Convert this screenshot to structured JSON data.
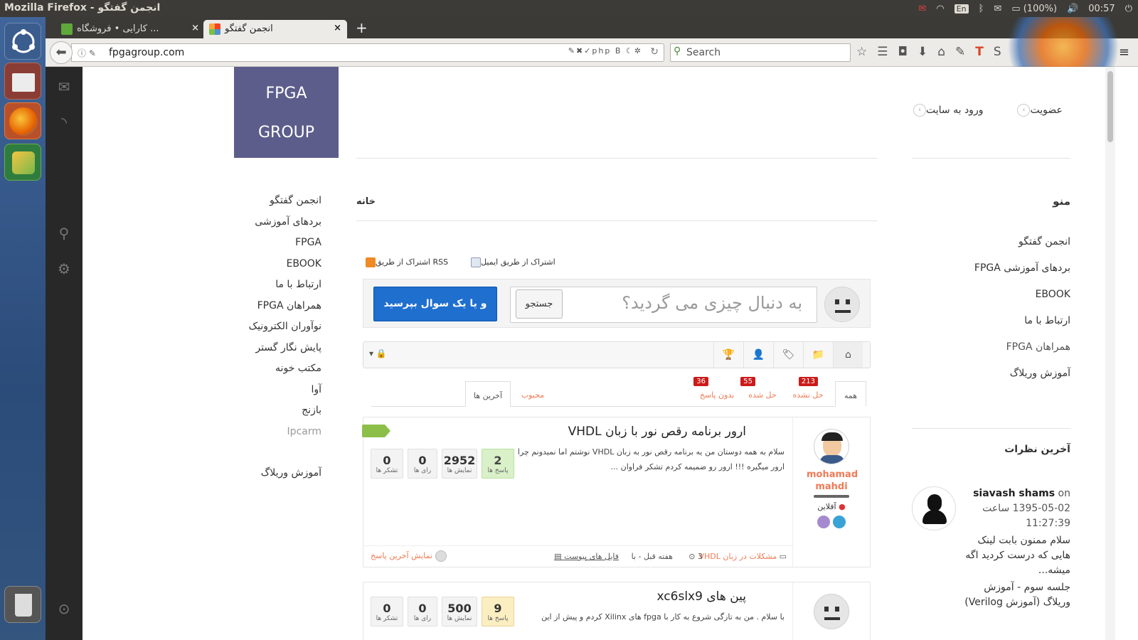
{
  "os": {
    "window_title": "Mozilla Firefox - انجمن گفتگو",
    "tray": {
      "lang": "En",
      "battery": "(100%)",
      "clock": "00:57"
    }
  },
  "browser": {
    "tabs": [
      {
        "label": "کارایی • فروشگاه ...",
        "active": false
      },
      {
        "label": "انجمن گفتگو",
        "active": true
      }
    ],
    "new_tab": "+",
    "url": "fpgagroup.com",
    "search_placeholder": "Search"
  },
  "site": {
    "logo_line1": "FPGA",
    "logo_line2": "GROUP",
    "auth": {
      "register": "عضویت",
      "login": "ورود به سایت"
    },
    "breadcrumb": "خانه",
    "left_menu": [
      "انجمن گفتگو",
      "بردهای آموزشی",
      "FPGA",
      "EBOOK",
      "ارتباط با ما",
      "همراهان FPGA",
      "نوآوران الکترونیک",
      "پایش نگار گستر",
      "مکتب خونه",
      "آوا",
      "بازنج",
      "Ipcarm",
      "آموزش وریلاگ"
    ],
    "right_menu": {
      "heading": "منو",
      "items": [
        "انجمن گفتگو",
        "بردهای آموزشی FPGA",
        "EBOOK",
        "ارتباط با ما",
        "همراهان FPGA",
        "آموزش وریلاگ"
      ]
    },
    "share": {
      "email": "اشتراک از طریق ایمیل",
      "rss": "اشتراک از طریق RSS"
    },
    "ask": {
      "button": "و یا یک سوال بپرسید",
      "search_placeholder": "به دنبال چیزی می گردید؟",
      "search_button": "جستجو"
    },
    "filters": {
      "all": "همه",
      "unsolved": "حل نشده",
      "unsolved_count": "213",
      "solved": "حل شده",
      "solved_count": "55",
      "unanswered": "بدون پاسخ",
      "unanswered_count": "36",
      "latest": "آخرین ها",
      "popular": "محبوب"
    },
    "questions": [
      {
        "author": "mohamad mahdi",
        "status": "آفلاین",
        "title": "ارور برنامه رقص نور با زبان VHDL",
        "excerpt": "سلام به همه دوستان من یه برنامه رقص نور به زبان VHDL نوشتم اما نمیدونم چرا ارور میگیره !!! ارور رو ضمیمه کردم تشکر فراوان ...",
        "stats": {
          "answers": "2",
          "answers_label": "پاسخ ها",
          "views": "2952",
          "views_label": "نمایش ها",
          "votes": "0",
          "votes_label": "رای ها",
          "thanks": "0",
          "thanks_label": "تشکر ها"
        },
        "foot_category": "مشکلات در زبان VHDL",
        "foot_count": "3",
        "foot_time": "هفته قبل - با",
        "foot_attach": "فایل های پیوست",
        "foot_last": "نمایش آخرین پاسخ"
      },
      {
        "title": "پین های xc6slx9",
        "excerpt": "با سلام . من به تازگی شروع به کار با fpga های Xilinx کردم و پیش از این",
        "stats": {
          "answers": "9",
          "answers_label": "پاسخ ها",
          "views": "500",
          "views_label": "نمایش ها",
          "votes": "0",
          "votes_label": "رای ها",
          "thanks": "0",
          "thanks_label": "تشکر ها"
        }
      }
    ],
    "comments": {
      "heading": "آخرین نظرات",
      "author": "siavash shams",
      "on": "on",
      "date": "1395-05-02 ساعت",
      "time": "11:27:39",
      "text": "سلام ممنون بابت لینک هایی که درست کردید اگه میشه...",
      "link": "جلسه سوم - آموزش وریلاگ (آموزش Verilog)"
    }
  }
}
